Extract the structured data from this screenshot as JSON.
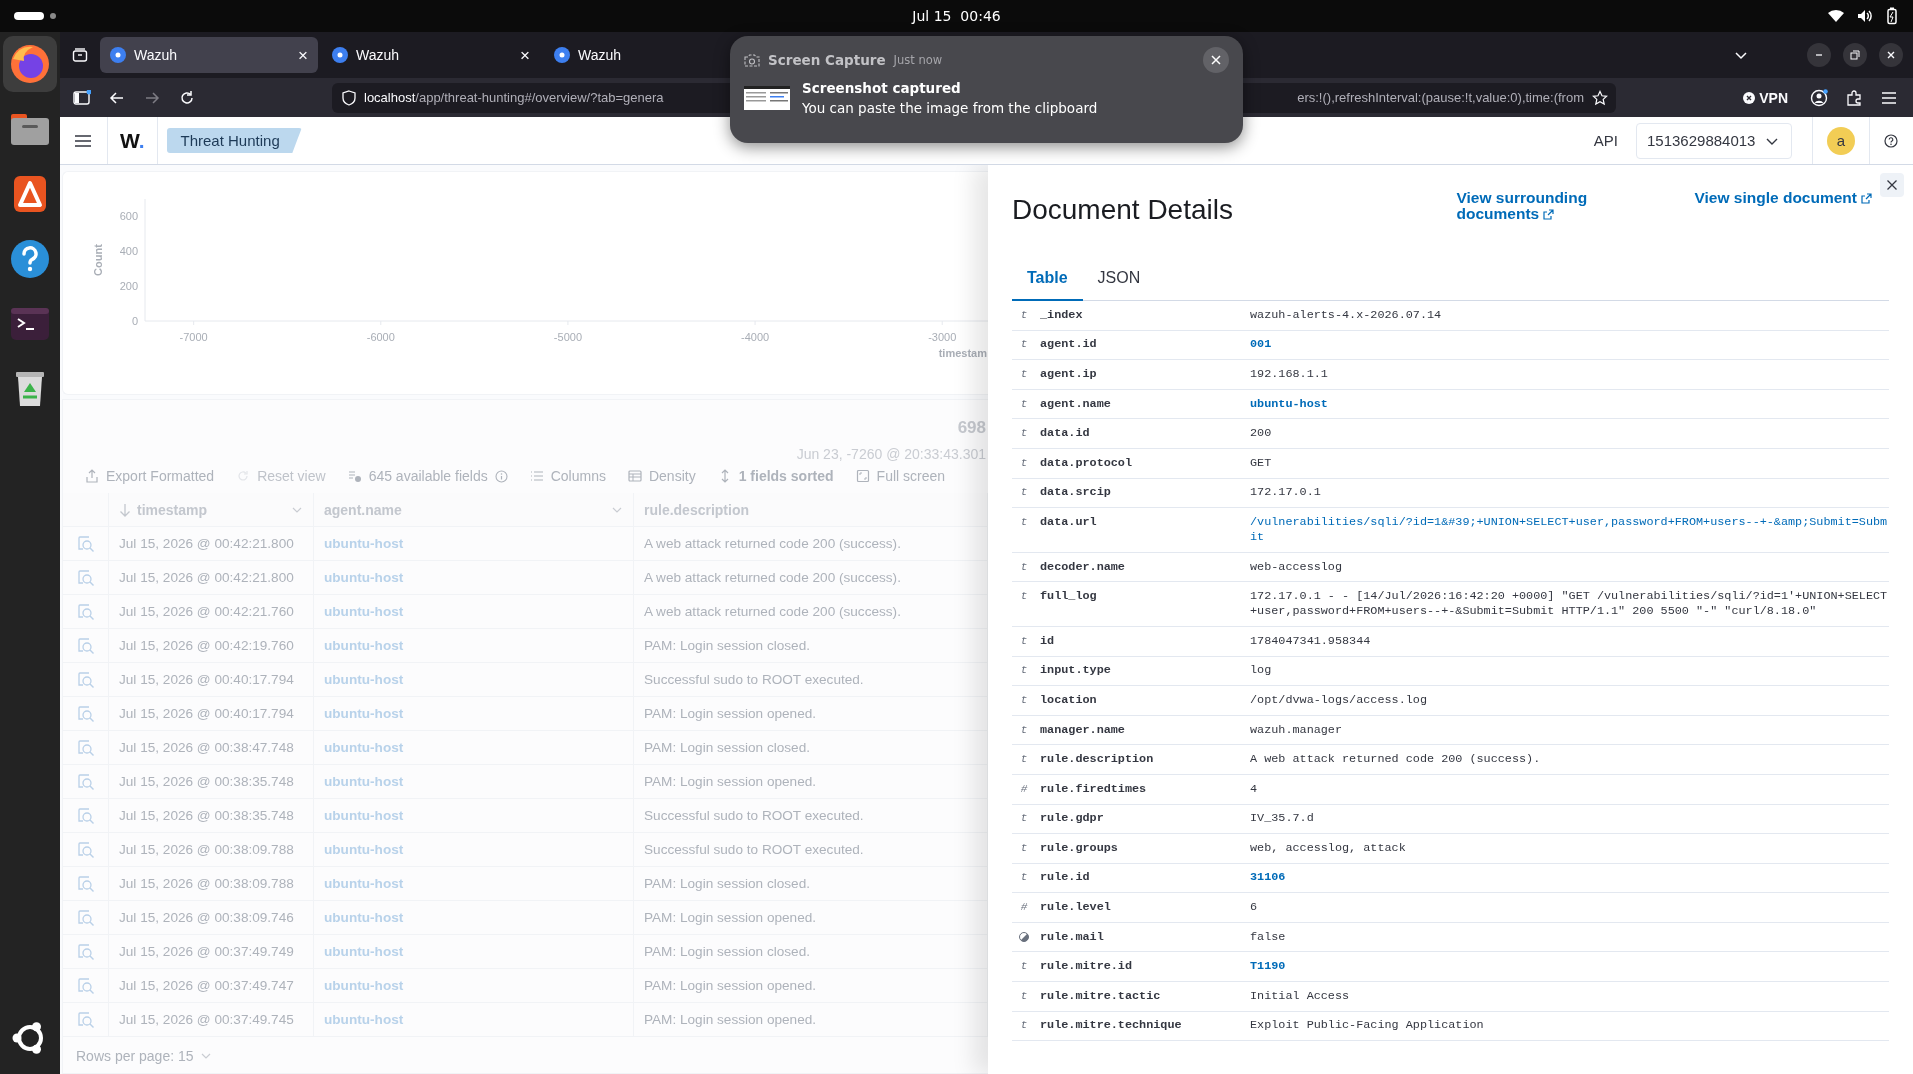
{
  "system_bar": {
    "clock": "Jul 15  00:46"
  },
  "dock": {
    "apps": [
      {
        "kind": "browser",
        "active": true
      },
      {
        "kind": "files",
        "active": false
      },
      {
        "kind": "store",
        "active": false
      },
      {
        "kind": "help",
        "active": false
      },
      {
        "kind": "terminal",
        "active": false
      },
      {
        "kind": "trash",
        "active": false
      }
    ],
    "show_apps": {
      "kind": "apps"
    }
  },
  "browser": {
    "tabs": [
      {
        "title": "Wazuh",
        "selected": true,
        "close": "×"
      },
      {
        "title": "Wazuh",
        "selected": false,
        "close": "×"
      },
      {
        "title": "Wazuh",
        "selected": false
      }
    ],
    "url_host": "localhost",
    "url_path": "/app/threat-hunting#/overview/?tab=genera",
    "url_end": "ers:!(),refreshInterval:(pause:!t,value:0),time:(from",
    "vpn": "VPN"
  },
  "app_header": {
    "logo_letter": "W",
    "logo_dot": ".",
    "breadcrumb": "Threat Hunting",
    "api_label": "API",
    "api_select": "1513629884013",
    "avatar": "a"
  },
  "discover": {
    "chart_data": {
      "type": "bar",
      "xlabel": "timestam",
      "ylabel": "Count",
      "xlim": [
        -7260,
        -2750
      ],
      "ylim": [
        0,
        700
      ],
      "xticks": [
        -7000,
        -6000,
        -5000,
        -4000,
        -3000
      ],
      "yticks": [
        0,
        200,
        400,
        600
      ]
    },
    "hits": "698",
    "time_range": "Jun 23, -7260 @ 20:33:43.301",
    "toolbar": [
      {
        "kind": "export",
        "label": "Export Formatted",
        "disabled": false
      },
      {
        "kind": "reset",
        "label": "Reset view",
        "disabled": true
      },
      {
        "kind": "fields",
        "label": "645 available fields",
        "disabled": false
      },
      {
        "kind": "columns",
        "label": "Columns",
        "disabled": false
      },
      {
        "kind": "density",
        "label": "Density",
        "disabled": false
      },
      {
        "kind": "sort",
        "label": "1 fields sorted",
        "disabled": false
      },
      {
        "kind": "fullscreen",
        "label": "Full screen",
        "disabled": false
      }
    ],
    "columns": [
      {
        "label": "timestamp",
        "sorted": true,
        "menu": true
      },
      {
        "label": "agent.name",
        "sorted": false,
        "menu": true
      },
      {
        "label": "rule.description",
        "sorted": false,
        "menu": false
      }
    ],
    "rows": [
      {
        "timestamp": "Jul 15, 2026 @ 00:42:21.800",
        "agent": "ubuntu-host",
        "description": "A web attack returned code 200 (success)."
      },
      {
        "timestamp": "Jul 15, 2026 @ 00:42:21.800",
        "agent": "ubuntu-host",
        "description": "A web attack returned code 200 (success)."
      },
      {
        "timestamp": "Jul 15, 2026 @ 00:42:21.760",
        "agent": "ubuntu-host",
        "description": "A web attack returned code 200 (success)."
      },
      {
        "timestamp": "Jul 15, 2026 @ 00:42:19.760",
        "agent": "ubuntu-host",
        "description": "PAM: Login session closed."
      },
      {
        "timestamp": "Jul 15, 2026 @ 00:40:17.794",
        "agent": "ubuntu-host",
        "description": "Successful sudo to ROOT executed."
      },
      {
        "timestamp": "Jul 15, 2026 @ 00:40:17.794",
        "agent": "ubuntu-host",
        "description": "PAM: Login session opened."
      },
      {
        "timestamp": "Jul 15, 2026 @ 00:38:47.748",
        "agent": "ubuntu-host",
        "description": "PAM: Login session closed."
      },
      {
        "timestamp": "Jul 15, 2026 @ 00:38:35.748",
        "agent": "ubuntu-host",
        "description": "PAM: Login session opened."
      },
      {
        "timestamp": "Jul 15, 2026 @ 00:38:35.748",
        "agent": "ubuntu-host",
        "description": "Successful sudo to ROOT executed."
      },
      {
        "timestamp": "Jul 15, 2026 @ 00:38:09.788",
        "agent": "ubuntu-host",
        "description": "Successful sudo to ROOT executed."
      },
      {
        "timestamp": "Jul 15, 2026 @ 00:38:09.788",
        "agent": "ubuntu-host",
        "description": "PAM: Login session closed."
      },
      {
        "timestamp": "Jul 15, 2026 @ 00:38:09.746",
        "agent": "ubuntu-host",
        "description": "PAM: Login session opened."
      },
      {
        "timestamp": "Jul 15, 2026 @ 00:37:49.749",
        "agent": "ubuntu-host",
        "description": "PAM: Login session closed."
      },
      {
        "timestamp": "Jul 15, 2026 @ 00:37:49.747",
        "agent": "ubuntu-host",
        "description": "PAM: Login session opened."
      },
      {
        "timestamp": "Jul 15, 2026 @ 00:37:49.745",
        "agent": "ubuntu-host",
        "description": "PAM: Login session opened."
      }
    ],
    "rows_per_page": "Rows per page: 15"
  },
  "flyout": {
    "title": "Document Details",
    "links": [
      {
        "label": "View surrounding documents"
      },
      {
        "label": "View single document"
      }
    ],
    "tabs": [
      {
        "label": "Table",
        "selected": true
      },
      {
        "label": "JSON",
        "selected": false
      }
    ],
    "fields": [
      {
        "kind": "text",
        "type_icon": "t",
        "name": "_index",
        "value": "wazuh-alerts-4.x-2026.07.14"
      },
      {
        "kind": "link",
        "type_icon": "t",
        "name": "agent.id",
        "value": "001"
      },
      {
        "kind": "text",
        "type_icon": "t",
        "name": "agent.ip",
        "value": "192.168.1.1"
      },
      {
        "kind": "link",
        "type_icon": "t",
        "name": "agent.name",
        "value": "ubuntu-host"
      },
      {
        "kind": "text",
        "type_icon": "t",
        "name": "data.id",
        "value": "200"
      },
      {
        "kind": "text",
        "type_icon": "t",
        "name": "data.protocol",
        "value": "GET"
      },
      {
        "kind": "text",
        "type_icon": "t",
        "name": "data.srcip",
        "value": "172.17.0.1"
      },
      {
        "kind": "url",
        "type_icon": "t",
        "name": "data.url",
        "value": "/vulnerabilities/sqli/?id=1&#39;+UNION+SELECT+user,password+FROM+users--+-&amp;Submit=Submit"
      },
      {
        "kind": "text",
        "type_icon": "t",
        "name": "decoder.name",
        "value": "web-accesslog"
      },
      {
        "kind": "text",
        "type_icon": "t",
        "name": "full_log",
        "value": "172.17.0.1 - - [14/Jul/2026:16:42:20 +0000] \"GET /vulnerabilities/sqli/?id=1'+UNION+SELECT+user,password+FROM+users--+-&Submit=Submit HTTP/1.1\" 200 5500 \"-\" \"curl/8.18.0\""
      },
      {
        "kind": "text",
        "type_icon": "t",
        "name": "id",
        "value": "1784047341.958344"
      },
      {
        "kind": "text",
        "type_icon": "t",
        "name": "input.type",
        "value": "log"
      },
      {
        "kind": "text",
        "type_icon": "t",
        "name": "location",
        "value": "/opt/dvwa-logs/access.log"
      },
      {
        "kind": "text",
        "type_icon": "t",
        "name": "manager.name",
        "value": "wazuh.manager"
      },
      {
        "kind": "text",
        "type_icon": "t",
        "name": "rule.description",
        "value": "A web attack returned code 200 (success)."
      },
      {
        "kind": "text",
        "type_icon": "#",
        "name": "rule.firedtimes",
        "value": "4"
      },
      {
        "kind": "text",
        "type_icon": "t",
        "name": "rule.gdpr",
        "value": "IV_35.7.d"
      },
      {
        "kind": "text",
        "type_icon": "t",
        "name": "rule.groups",
        "value": "web, accesslog, attack"
      },
      {
        "kind": "link",
        "type_icon": "t",
        "name": "rule.id",
        "value": "31106"
      },
      {
        "kind": "text",
        "type_icon": "#",
        "name": "rule.level",
        "value": "6"
      },
      {
        "kind": "boolean",
        "name": "rule.mail",
        "value": "false"
      },
      {
        "kind": "link",
        "type_icon": "t",
        "name": "rule.mitre.id",
        "value": "T1190"
      },
      {
        "kind": "text",
        "type_icon": "t",
        "name": "rule.mitre.tactic",
        "value": "Initial Access"
      },
      {
        "kind": "text",
        "type_icon": "t",
        "name": "rule.mitre.technique",
        "value": "Exploit Public-Facing Application"
      }
    ]
  },
  "toast": {
    "app": "Screen Capture",
    "time": "Just now",
    "title": "Screenshot captured",
    "body": "You can paste the image from the clipboard"
  }
}
